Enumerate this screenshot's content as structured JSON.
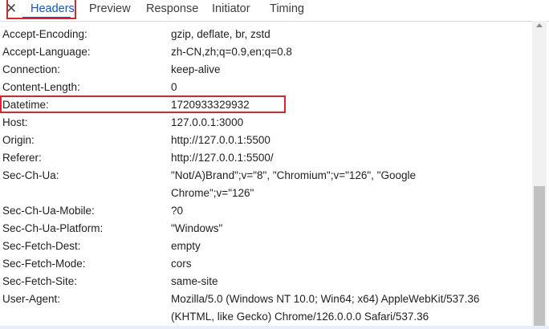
{
  "tabs": {
    "close_label": "✕",
    "items": [
      "Headers",
      "Preview",
      "Response",
      "Initiator",
      "Timing"
    ],
    "active": "Headers"
  },
  "headers": [
    {
      "name": "Accept-Encoding:",
      "value": "gzip, deflate, br, zstd"
    },
    {
      "name": "Accept-Language:",
      "value": "zh-CN,zh;q=0.9,en;q=0.8"
    },
    {
      "name": "Connection:",
      "value": "keep-alive"
    },
    {
      "name": "Content-Length:",
      "value": "0"
    },
    {
      "name": "Datetime:",
      "value": "1720933329932"
    },
    {
      "name": "Host:",
      "value": "127.0.0.1:3000"
    },
    {
      "name": "Origin:",
      "value": "http://127.0.0.1:5500"
    },
    {
      "name": "Referer:",
      "value": "http://127.0.0.1:5500/"
    },
    {
      "name": "Sec-Ch-Ua:",
      "value": "\"Not/A)Brand\";v=\"8\", \"Chromium\";v=\"126\", \"Google Chrome\";v=\"126\""
    },
    {
      "name": "Sec-Ch-Ua-Mobile:",
      "value": "?0"
    },
    {
      "name": "Sec-Ch-Ua-Platform:",
      "value": "\"Windows\""
    },
    {
      "name": "Sec-Fetch-Dest:",
      "value": "empty"
    },
    {
      "name": "Sec-Fetch-Mode:",
      "value": "cors"
    },
    {
      "name": "Sec-Fetch-Site:",
      "value": "same-site"
    },
    {
      "name": "User-Agent:",
      "value": "Mozilla/5.0 (Windows NT 10.0; Win64; x64) AppleWebKit/537.36 (KHTML, like Gecko) Chrome/126.0.0.0 Safari/537.36"
    }
  ],
  "colors": {
    "accent": "#0b57d0",
    "highlight": "#d9252d"
  }
}
